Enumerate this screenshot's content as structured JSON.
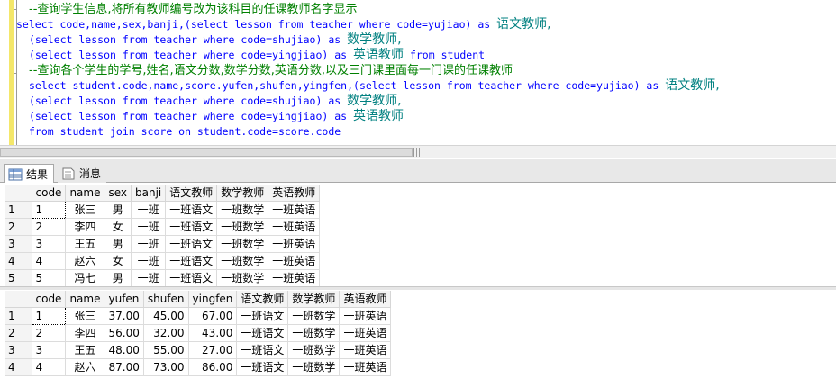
{
  "editor": {
    "lines": [
      {
        "type": "comment",
        "text": "--查询学生信息,将所有教师编号改为该科目的任课教师名字显示"
      },
      {
        "type": "code",
        "text": "select code,name,sex,banji,(select lesson from teacher where code=yujiao) as ",
        "alias": "语文教师,"
      },
      {
        "type": "code",
        "text": "(select lesson from teacher where code=shujiao) as ",
        "alias": "数学教师,"
      },
      {
        "type": "code",
        "text": "(select lesson from teacher where code=yingjiao) as ",
        "alias": "英语教师",
        "tail": " from student"
      },
      {
        "type": "comment",
        "text": "--查询各个学生的学号,姓名,语文分数,数学分数,英语分数,以及三门课里面每一门课的任课教师"
      },
      {
        "type": "code",
        "text": "select student.code,name,score.yufen,shufen,yingfen,(select lesson from teacher where code=yujiao) as ",
        "alias": "语文教师,"
      },
      {
        "type": "code",
        "text": "(select lesson from teacher where code=shujiao) as ",
        "alias": "数学教师,"
      },
      {
        "type": "code",
        "text": "(select lesson from teacher where code=yingjiao) as ",
        "alias": "英语教师"
      },
      {
        "type": "code",
        "text": "from student join score on student.code=score.code"
      }
    ]
  },
  "tabs": [
    {
      "label": "结果",
      "icon": "grid-results-icon",
      "active": true
    },
    {
      "label": "消息",
      "icon": "messages-icon",
      "active": false
    }
  ],
  "results": [
    {
      "columns": [
        "code",
        "name",
        "sex",
        "banji",
        "语文教师",
        "数学教师",
        "英语教师"
      ],
      "rows": [
        [
          "1",
          "1",
          "张三",
          "男",
          "一班",
          "一班语文",
          "一班数学",
          "一班英语"
        ],
        [
          "2",
          "2",
          "李四",
          "女",
          "一班",
          "一班语文",
          "一班数学",
          "一班英语"
        ],
        [
          "3",
          "3",
          "王五",
          "男",
          "一班",
          "一班语文",
          "一班数学",
          "一班英语"
        ],
        [
          "4",
          "4",
          "赵六",
          "女",
          "一班",
          "一班语文",
          "一班数学",
          "一班英语"
        ],
        [
          "5",
          "5",
          "冯七",
          "男",
          "一班",
          "一班语文",
          "一班数学",
          "一班英语"
        ]
      ]
    },
    {
      "columns": [
        "code",
        "name",
        "yufen",
        "shufen",
        "yingfen",
        "语文教师",
        "数学教师",
        "英语教师"
      ],
      "rows": [
        [
          "1",
          "1",
          "张三",
          "37.00",
          "45.00",
          "67.00",
          "一班语文",
          "一班数学",
          "一班英语"
        ],
        [
          "2",
          "2",
          "李四",
          "56.00",
          "32.00",
          "43.00",
          "一班语文",
          "一班数学",
          "一班英语"
        ],
        [
          "3",
          "3",
          "王五",
          "48.00",
          "55.00",
          "27.00",
          "一班语文",
          "一班数学",
          "一班英语"
        ],
        [
          "4",
          "4",
          "赵六",
          "87.00",
          "73.00",
          "86.00",
          "一班语文",
          "一班数学",
          "一班英语"
        ]
      ]
    }
  ]
}
